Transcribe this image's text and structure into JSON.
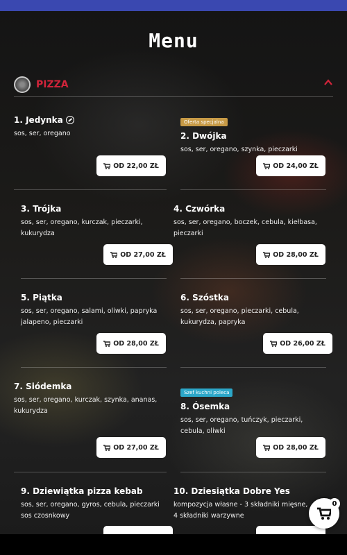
{
  "page": {
    "title": "Menu"
  },
  "category": {
    "name": "PIZZA",
    "icon": "pizza-icon",
    "collapse_icon": "chevron-up-icon",
    "accent": "#d0243a"
  },
  "items": [
    {
      "name": "1. Jedynka",
      "desc": "sos, ser, oregano",
      "price": "OD 22,00 ZŁ",
      "badge": "",
      "icon": "leaf-icon"
    },
    {
      "name": "2. Dwójka",
      "desc": "sos, ser, oregano, szynka, pieczarki",
      "price": "OD 24,00 ZŁ",
      "badge": "Oferta specjalna"
    },
    {
      "name": "3. Trójka",
      "desc": "sos, ser, oregano, kurczak, pieczarki, kukurydza",
      "price": "OD 27,00 ZŁ",
      "badge": ""
    },
    {
      "name": "4. Czwórka",
      "desc": "sos, ser, oregano, boczek, cebula, kiełbasa, pieczarki",
      "price": "OD 28,00 ZŁ",
      "badge": ""
    },
    {
      "name": "5. Piątka",
      "desc": "sos, ser, oregano, salami, oliwki, papryka jalapeno, pieczarki",
      "price": "OD 28,00 ZŁ",
      "badge": ""
    },
    {
      "name": "6. Szóstka",
      "desc": "sos, ser, oregano, pieczarki, cebula, kukurydza, papryka",
      "price": "OD 26,00 ZŁ",
      "badge": ""
    },
    {
      "name": "7. Siódemka",
      "desc": "sos, ser, oregano, kurczak, szynka, ananas, kukurydza",
      "price": "OD 27,00 ZŁ",
      "badge": ""
    },
    {
      "name": "8. Ósemka",
      "desc": "sos, ser, oregano, tuńczyk, pieczarki, cebula, oliwki",
      "price": "OD 28,00 ZŁ",
      "badge": "Szef kuchni poleca"
    },
    {
      "name": "9. Dziewiątka pizza kebab",
      "desc": "sos, ser, oregano, gyros, cebula, pieczarki sos czosnkowy",
      "price": "",
      "badge": ""
    },
    {
      "name": "10. Dziesiątka Dobre Yes",
      "desc": "kompozycja własne - 3 składniki mięsne, 4 składniki warzywne",
      "price": "",
      "badge": ""
    }
  ],
  "cart": {
    "count": "0",
    "icon": "cart-icon"
  }
}
